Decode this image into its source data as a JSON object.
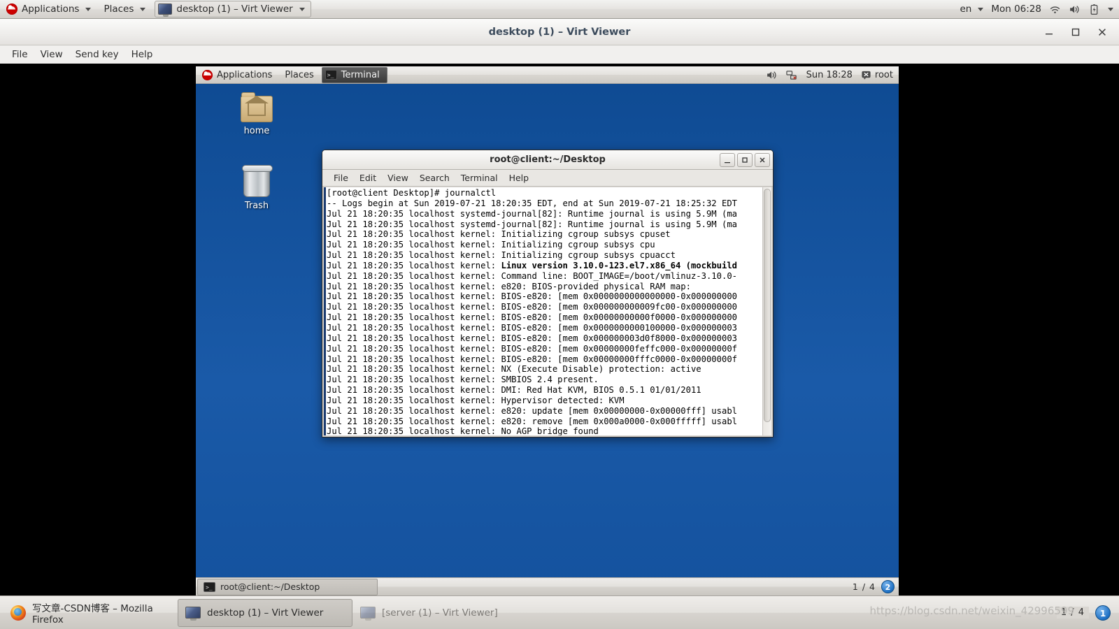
{
  "host": {
    "top_panel": {
      "applications_label": "Applications",
      "places_label": "Places",
      "window_task_label": "desktop (1) – Virt Viewer",
      "keyboard_layout": "en",
      "clock": "Mon 06:28",
      "icons": [
        "wifi-icon",
        "volume-icon",
        "battery-icon",
        "chevron-down-icon"
      ]
    },
    "taskbar": {
      "buttons": [
        {
          "label": "写文章-CSDN博客 – Mozilla Firefox",
          "icon": "firefox-icon",
          "active": false
        },
        {
          "label": "desktop (1) – Virt Viewer",
          "icon": "monitor-icon",
          "active": true
        },
        {
          "label": "[server (1) – Virt Viewer]",
          "icon": "monitor-icon",
          "active": false
        }
      ],
      "workspace_indicator": "1 / 4",
      "workspace_number": "1",
      "watermark": "https://blog.csdn.net/weixin_42996599"
    }
  },
  "virt_viewer": {
    "title": "desktop (1) – Virt Viewer",
    "menu": [
      "File",
      "View",
      "Send key",
      "Help"
    ],
    "window_buttons": {
      "minimize": "–",
      "maximize": "▫",
      "close": "✕"
    }
  },
  "guest": {
    "top_panel": {
      "applications_label": "Applications",
      "places_label": "Places",
      "task_label": "Terminal",
      "clock": "Sun 18:28",
      "user": "root",
      "icons": [
        "volume-icon",
        "network-disconnected-icon",
        "user-icon"
      ]
    },
    "desktop_icons": [
      {
        "label": "home",
        "icon": "home-folder-icon"
      },
      {
        "label": "Trash",
        "icon": "trash-icon"
      }
    ],
    "bottom_panel": {
      "task_label": "root@client:~/Desktop",
      "workspace_indicator": "1 / 4",
      "workspace_number": "2"
    }
  },
  "terminal": {
    "title": "root@client:~/Desktop",
    "menu": [
      "File",
      "Edit",
      "View",
      "Search",
      "Terminal",
      "Help"
    ],
    "window_buttons": {
      "minimize": "_",
      "maximize": "▫",
      "close": "✕"
    },
    "lines": [
      {
        "text": "[root@client Desktop]# journalctl",
        "bold": false
      },
      {
        "text": "-- Logs begin at Sun 2019-07-21 18:20:35 EDT, end at Sun 2019-07-21 18:25:32 EDT",
        "bold": false
      },
      {
        "text": "Jul 21 18:20:35 localhost systemd-journal[82]: Runtime journal is using 5.9M (ma",
        "bold": false
      },
      {
        "text": "Jul 21 18:20:35 localhost systemd-journal[82]: Runtime journal is using 5.9M (ma",
        "bold": false
      },
      {
        "text": "Jul 21 18:20:35 localhost kernel: Initializing cgroup subsys cpuset",
        "bold": false
      },
      {
        "text": "Jul 21 18:20:35 localhost kernel: Initializing cgroup subsys cpu",
        "bold": false
      },
      {
        "text": "Jul 21 18:20:35 localhost kernel: Initializing cgroup subsys cpuacct",
        "bold": false
      },
      {
        "text": "Jul 21 18:20:35 localhost kernel: ",
        "bold_suffix": "Linux version 3.10.0-123.el7.x86_64 (mockbuild"
      },
      {
        "text": "Jul 21 18:20:35 localhost kernel: Command line: BOOT_IMAGE=/boot/vmlinuz-3.10.0-",
        "bold": false
      },
      {
        "text": "Jul 21 18:20:35 localhost kernel: e820: BIOS-provided physical RAM map:",
        "bold": false
      },
      {
        "text": "Jul 21 18:20:35 localhost kernel: BIOS-e820: [mem 0x0000000000000000-0x000000000",
        "bold": false
      },
      {
        "text": "Jul 21 18:20:35 localhost kernel: BIOS-e820: [mem 0x000000000009fc00-0x000000000",
        "bold": false
      },
      {
        "text": "Jul 21 18:20:35 localhost kernel: BIOS-e820: [mem 0x00000000000f0000-0x000000000",
        "bold": false
      },
      {
        "text": "Jul 21 18:20:35 localhost kernel: BIOS-e820: [mem 0x0000000000100000-0x000000003",
        "bold": false
      },
      {
        "text": "Jul 21 18:20:35 localhost kernel: BIOS-e820: [mem 0x000000003d0f8000-0x000000003",
        "bold": false
      },
      {
        "text": "Jul 21 18:20:35 localhost kernel: BIOS-e820: [mem 0x00000000feffc000-0x00000000f",
        "bold": false
      },
      {
        "text": "Jul 21 18:20:35 localhost kernel: BIOS-e820: [mem 0x00000000fffc0000-0x00000000f",
        "bold": false
      },
      {
        "text": "Jul 21 18:20:35 localhost kernel: NX (Execute Disable) protection: active",
        "bold": false
      },
      {
        "text": "Jul 21 18:20:35 localhost kernel: SMBIOS 2.4 present.",
        "bold": false
      },
      {
        "text": "Jul 21 18:20:35 localhost kernel: DMI: Red Hat KVM, BIOS 0.5.1 01/01/2011",
        "bold": false
      },
      {
        "text": "Jul 21 18:20:35 localhost kernel: Hypervisor detected: KVM",
        "bold": false
      },
      {
        "text": "Jul 21 18:20:35 localhost kernel: e820: update [mem 0x00000000-0x00000fff] usabl",
        "bold": false
      },
      {
        "text": "Jul 21 18:20:35 localhost kernel: e820: remove [mem 0x000a0000-0x000fffff] usabl",
        "bold": false
      },
      {
        "text": "Jul 21 18:20:35 localhost kernel: No AGP bridge found",
        "bold": false
      }
    ]
  },
  "colors": {
    "desktop_blue": "#15539e",
    "panel_grey": "#d9d6d1",
    "terminal_bg": "#ffffff",
    "terminal_fg": "#000000",
    "accent_blue": "#1d6fc4"
  }
}
